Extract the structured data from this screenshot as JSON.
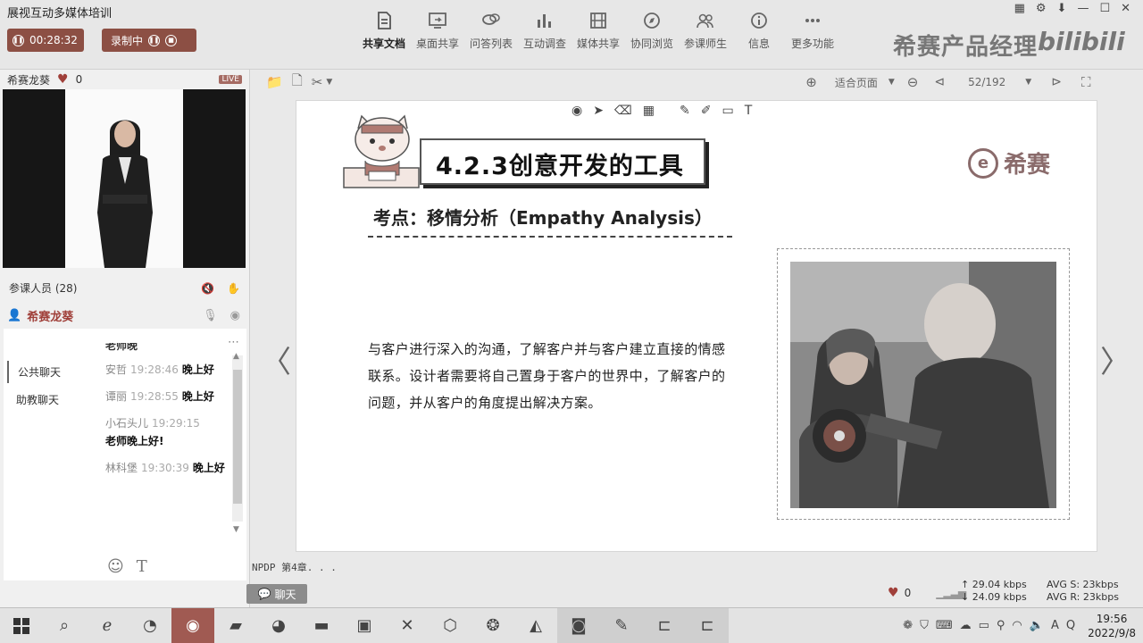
{
  "app": {
    "title": "展视互动多媒体培训",
    "timer": "00:28:32",
    "recording_label": "录制中",
    "brand": "希赛产品经理",
    "bili": "bilibili"
  },
  "toolbar": [
    {
      "label": "共享文档",
      "icon": "document-icon",
      "active": true
    },
    {
      "label": "桌面共享",
      "icon": "screen-share-icon"
    },
    {
      "label": "问答列表",
      "icon": "qa-icon"
    },
    {
      "label": "互动调查",
      "icon": "chart-icon"
    },
    {
      "label": "媒体共享",
      "icon": "film-icon"
    },
    {
      "label": "协同浏览",
      "icon": "compass-icon"
    },
    {
      "label": "参课师生",
      "icon": "people-icon"
    },
    {
      "label": "信息",
      "icon": "info-icon"
    },
    {
      "label": "更多功能",
      "icon": "more-icon"
    }
  ],
  "presenter": {
    "name": "希赛龙葵",
    "likes": "0",
    "live_tag": "LIVE"
  },
  "participants": {
    "label": "参课人员 (28)",
    "host": "希赛龙葵"
  },
  "chat": {
    "tabs": [
      "公共聊天",
      "助教聊天"
    ],
    "top_fragment": "老师晚",
    "messages": [
      {
        "name": "安哲",
        "time": "19:28:46",
        "text": "晚上好"
      },
      {
        "name": "谭丽",
        "time": "19:28:55",
        "text": "晚上好"
      },
      {
        "name": "小石头儿",
        "time": "19:29:15",
        "text": "老师晚上好!"
      },
      {
        "name": "林科堡",
        "time": "19:30:39",
        "text": "晚上好"
      }
    ],
    "button": "聊天"
  },
  "doc_toolbar": {
    "fit": "适合页面",
    "page": "52/192"
  },
  "slide": {
    "title": "4.2.3创意开发的工具",
    "subtitle": "考点：移情分析（Empathy Analysis）",
    "logo": "希赛",
    "body": "与客户进行深入的沟通，了解客户并与客户建立直接的情感联系。设计者需要将自己置身于客户的世界中，了解客户的问题，并从客户的角度提出解决方案。"
  },
  "doc_name": "NPDP 第4章. . .",
  "status": {
    "likes": "0",
    "up_rate": "29.04 kbps",
    "down_rate": "24.09 kbps",
    "avg_s": "AVG S: 23kbps",
    "avg_r": "AVG R: 23kbps"
  },
  "taskbar": {
    "time": "19:56",
    "date": "2022/9/8"
  }
}
